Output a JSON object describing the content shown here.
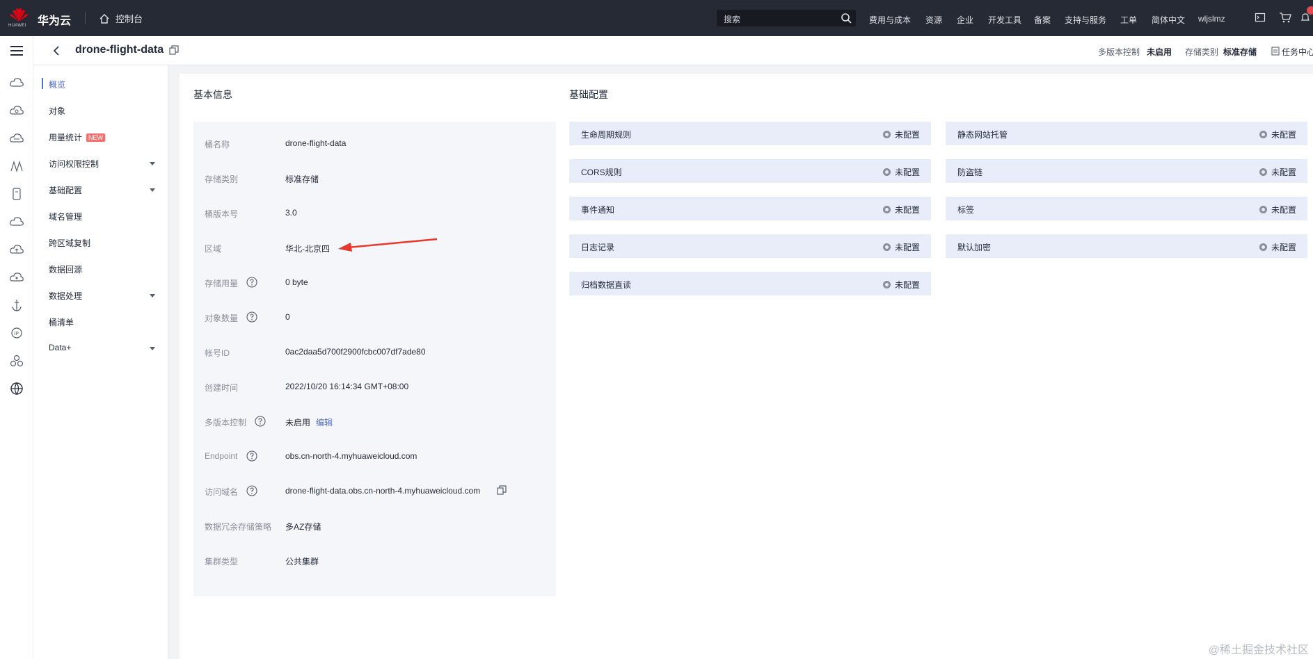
{
  "topbar": {
    "brand": "华为云",
    "logo_text": "HUAWEI",
    "console": "控制台",
    "search_placeholder": "搜索",
    "nav": [
      "费用与成本",
      "资源",
      "企业",
      "开发工具",
      "备案",
      "支持与服务",
      "工单",
      "简体中文",
      "wljslmz"
    ]
  },
  "header": {
    "bucket_name": "drone-flight-data",
    "versioning_label": "多版本控制",
    "versioning_value": "未启用",
    "storage_class_label": "存储类别",
    "storage_class_value": "标准存储",
    "task_center": "任务中心"
  },
  "subnav": {
    "items": [
      {
        "label": "概览",
        "active": true
      },
      {
        "label": "对象"
      },
      {
        "label": "用量统计",
        "badge": "NEW"
      },
      {
        "label": "访问权限控制",
        "expandable": true
      },
      {
        "label": "基础配置",
        "expandable": true
      },
      {
        "label": "域名管理"
      },
      {
        "label": "跨区域复制"
      },
      {
        "label": "数据回源"
      },
      {
        "label": "数据处理",
        "expandable": true
      },
      {
        "label": "桶清单"
      },
      {
        "label": "Data+",
        "expandable": true
      }
    ]
  },
  "basic_info": {
    "title": "基本信息",
    "rows": [
      {
        "label": "桶名称",
        "value": "drone-flight-data"
      },
      {
        "label": "存储类别",
        "value": "标准存储"
      },
      {
        "label": "桶版本号",
        "value": "3.0"
      },
      {
        "label": "区域",
        "value": "华北-北京四"
      },
      {
        "label": "存储用量",
        "value": "0 byte",
        "help": true
      },
      {
        "label": "对象数量",
        "value": "0",
        "help": true
      },
      {
        "label": "帐号ID",
        "value": "0ac2daa5d700f2900fcbc007df7ade80"
      },
      {
        "label": "创建时间",
        "value": "2022/10/20 16:14:34 GMT+08:00"
      },
      {
        "label": "多版本控制",
        "value": "未启用",
        "help": true,
        "link": "编辑"
      },
      {
        "label": "Endpoint",
        "value": "obs.cn-north-4.myhuaweicloud.com",
        "help": true
      },
      {
        "label": "访问域名",
        "value": "drone-flight-data.obs.cn-north-4.myhuaweicloud.com",
        "help": true,
        "copy": true
      },
      {
        "label": "数据冗余存储策略",
        "value": "多AZ存储"
      },
      {
        "label": "集群类型",
        "value": "公共集群"
      }
    ]
  },
  "basic_config": {
    "title": "基础配置",
    "left": [
      {
        "name": "生命周期规则",
        "status": "未配置"
      },
      {
        "name": "CORS规则",
        "status": "未配置"
      },
      {
        "name": "事件通知",
        "status": "未配置"
      },
      {
        "name": "日志记录",
        "status": "未配置"
      },
      {
        "name": "归档数据直读",
        "status": "未配置"
      }
    ],
    "right": [
      {
        "name": "静态网站托管",
        "status": "未配置"
      },
      {
        "name": "防盗链",
        "status": "未配置"
      },
      {
        "name": "标签",
        "status": "未配置"
      },
      {
        "name": "默认加密",
        "status": "未配置"
      }
    ]
  },
  "annotation": {
    "type": "red-arrow",
    "color": "#e8382e"
  },
  "watermark": "@稀土掘金技术社区",
  "colors": {
    "topbar": "#252a35",
    "accent": "#526ecc",
    "config_bg": "#e9edf9",
    "panel_bg": "#f5f6f9",
    "badge": "#f66f6a"
  }
}
